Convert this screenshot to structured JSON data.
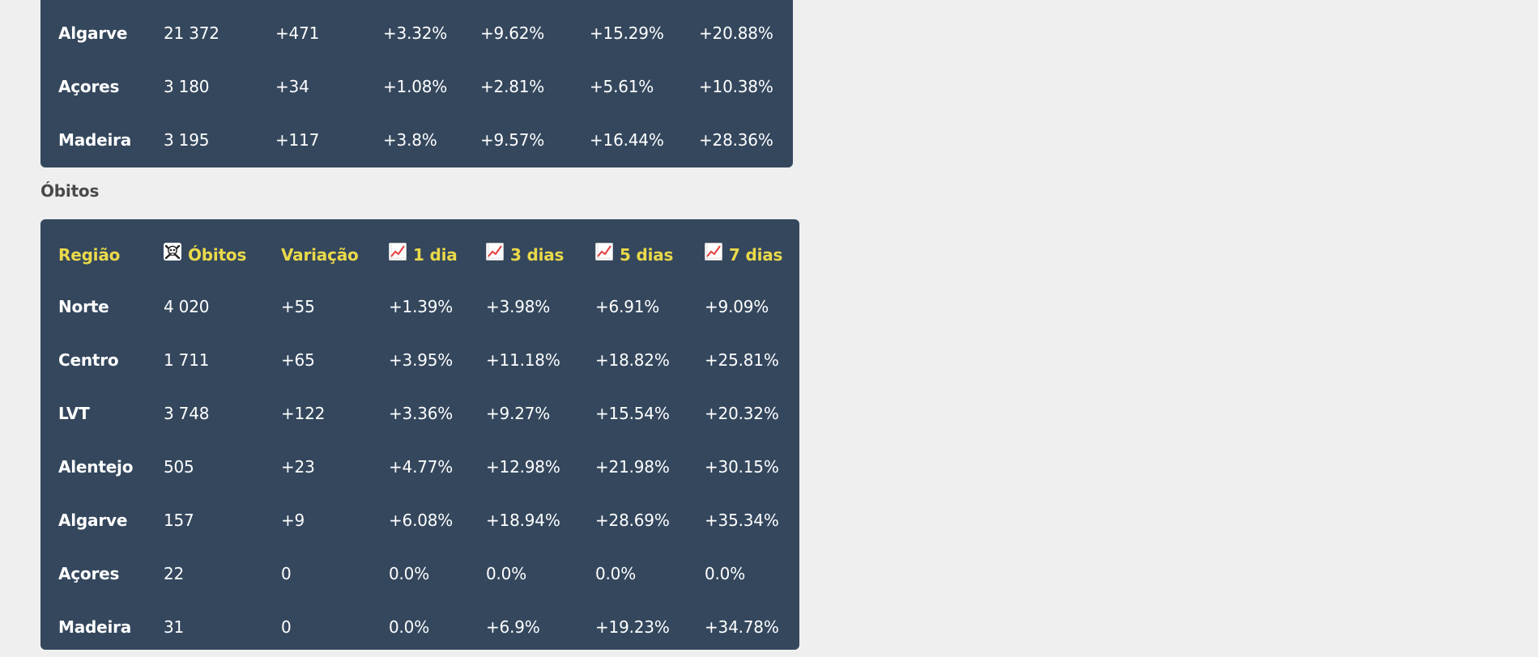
{
  "top_table": {
    "rows": [
      {
        "region": "Algarve",
        "value": "21 372",
        "variation": "+471",
        "d1": "+3.32%",
        "d3": "+9.62%",
        "d5": "+15.29%",
        "d7": "+20.88%"
      },
      {
        "region": "Açores",
        "value": "3 180",
        "variation": "+34",
        "d1": "+1.08%",
        "d3": "+2.81%",
        "d5": "+5.61%",
        "d7": "+10.38%"
      },
      {
        "region": "Madeira",
        "value": "3 195",
        "variation": "+117",
        "d1": "+3.8%",
        "d3": "+9.57%",
        "d5": "+16.44%",
        "d7": "+28.36%"
      }
    ]
  },
  "obitos_section": {
    "title": "Óbitos",
    "header": {
      "region": "Região",
      "value": "Óbitos",
      "variation": "Variação",
      "d1": "1 dia",
      "d3": "3 dias",
      "d5": "5 dias",
      "d7": "7 dias"
    },
    "icons": {
      "value": "skull-crossbones-icon",
      "trend": "chart-increasing-icon"
    },
    "rows": [
      {
        "region": "Norte",
        "value": "4 020",
        "variation": "+55",
        "d1": "+1.39%",
        "d3": "+3.98%",
        "d5": "+6.91%",
        "d7": "+9.09%"
      },
      {
        "region": "Centro",
        "value": "1 711",
        "variation": "+65",
        "d1": "+3.95%",
        "d3": "+11.18%",
        "d5": "+18.82%",
        "d7": "+25.81%"
      },
      {
        "region": "LVT",
        "value": "3 748",
        "variation": "+122",
        "d1": "+3.36%",
        "d3": "+9.27%",
        "d5": "+15.54%",
        "d7": "+20.32%"
      },
      {
        "region": "Alentejo",
        "value": "505",
        "variation": "+23",
        "d1": "+4.77%",
        "d3": "+12.98%",
        "d5": "+21.98%",
        "d7": "+30.15%"
      },
      {
        "region": "Algarve",
        "value": "157",
        "variation": "+9",
        "d1": "+6.08%",
        "d3": "+18.94%",
        "d5": "+28.69%",
        "d7": "+35.34%"
      },
      {
        "region": "Açores",
        "value": "22",
        "variation": "0",
        "d1": "0.0%",
        "d3": "0.0%",
        "d5": "0.0%",
        "d7": "0.0%"
      },
      {
        "region": "Madeira",
        "value": "31",
        "variation": "0",
        "d1": "0.0%",
        "d3": "+6.9%",
        "d5": "+19.23%",
        "d7": "+34.78%"
      }
    ]
  },
  "colors": {
    "page_background": "#efefef",
    "card_background": "#34475d",
    "header_text": "#ead94a",
    "cell_text": "#ffffff",
    "section_title": "#4a4a4a"
  }
}
